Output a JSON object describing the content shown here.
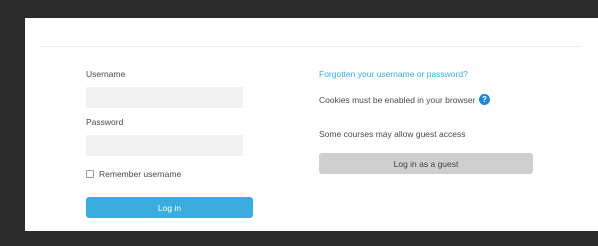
{
  "login_form": {
    "username_label": "Username",
    "username_value": "",
    "password_label": "Password",
    "password_value": "",
    "remember_label": "Remember username",
    "remember_checked": false,
    "login_button_label": "Log in"
  },
  "side_info": {
    "forgot_link": "Forgotten your username or password?",
    "cookies_notice": "Cookies must be enabled in your browser",
    "help_icon_glyph": "?",
    "guest_notice": "Some courses may allow guest access",
    "guest_button_label": "Log in as a guest"
  },
  "colors": {
    "primary_button": "#39aede",
    "link": "#39aede",
    "help_icon": "#1e88d8",
    "secondary_button": "#cfcfcf",
    "background": "#2b2b2b"
  },
  "icons": {
    "help": "question-circle-icon"
  }
}
